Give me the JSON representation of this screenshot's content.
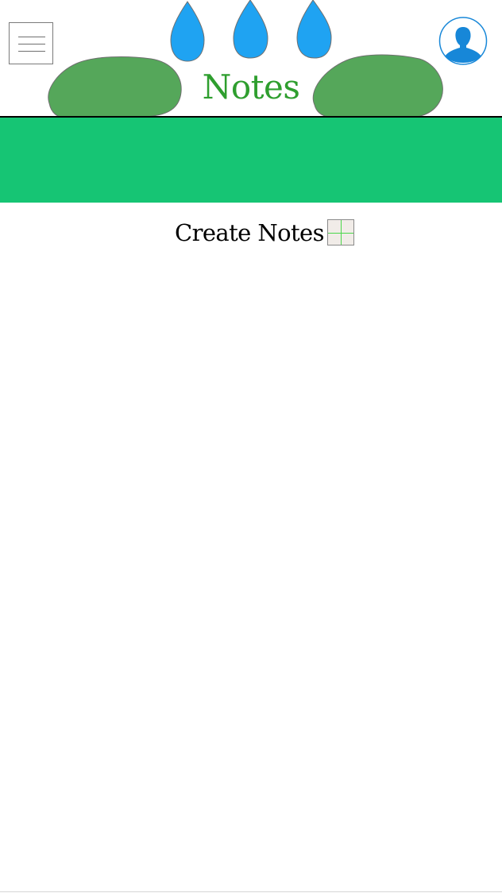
{
  "app": {
    "title": "Notes"
  },
  "header": {
    "menu_icon": "hamburger-menu-icon",
    "profile_icon": "user-profile-icon",
    "title_color": "#2e9e2e",
    "drop_color": "#1fa3f2",
    "blob_color": "#55a75a",
    "avatar_color": "#1787d8"
  },
  "banner": {
    "color": "#16c574"
  },
  "create_notes": {
    "label": "Create Notes",
    "add_icon": "plus-grid-icon"
  }
}
